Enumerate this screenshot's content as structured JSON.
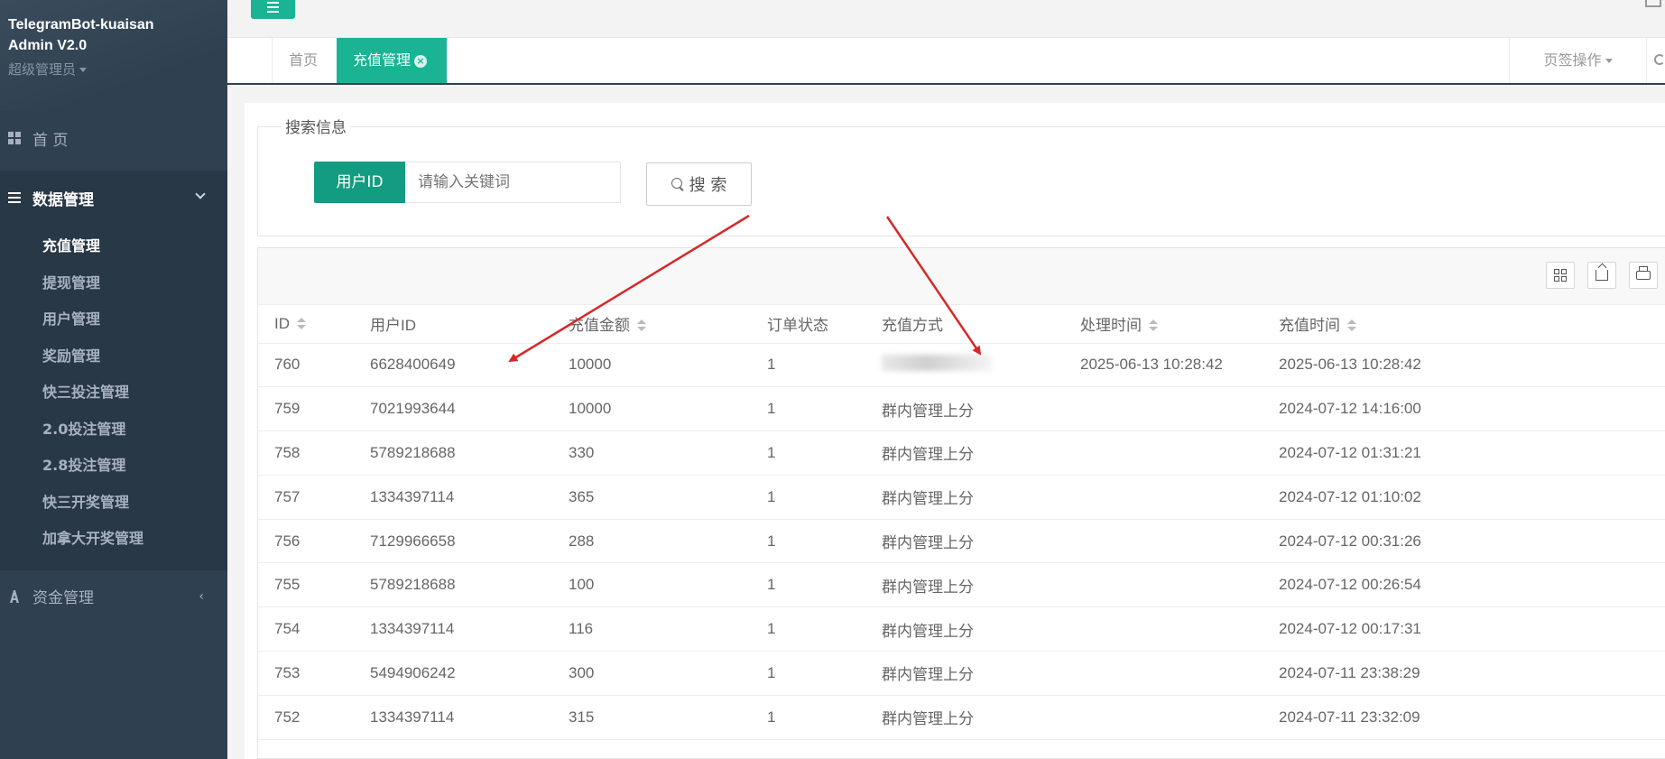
{
  "sidebar": {
    "brand_line1": "TelegramBot-kuaisan",
    "brand_line2": "Admin V2.0",
    "role": "超级管理员",
    "home": "首 页",
    "data_mgmt": "数据管理",
    "sub_items": [
      "充值管理",
      "提现管理",
      "用户管理",
      "奖励管理",
      "快三投注管理",
      "2.0投注管理",
      "2.8投注管理",
      "快三开奖管理",
      "加拿大开奖管理"
    ],
    "fund_mgmt": "资金管理"
  },
  "tabs": {
    "home": "首页",
    "active": "充值管理",
    "ops": "页签操作"
  },
  "search": {
    "legend": "搜索信息",
    "field_label": "用户ID",
    "placeholder": "请输入关键词",
    "button": "搜 索"
  },
  "table": {
    "columns": [
      "ID",
      "用户ID",
      "充值金额",
      "订单状态",
      "充值方式",
      "处理时间",
      "充值时间"
    ],
    "rows": [
      {
        "id": "760",
        "uid": "6628400649",
        "amount": "10000",
        "status": "1",
        "method": "",
        "processed": "2025-06-13 10:28:42",
        "time": "2025-06-13 10:28:42"
      },
      {
        "id": "759",
        "uid": "7021993644",
        "amount": "10000",
        "status": "1",
        "method": "群内管理上分",
        "processed": "",
        "time": "2024-07-12 14:16:00"
      },
      {
        "id": "758",
        "uid": "5789218688",
        "amount": "330",
        "status": "1",
        "method": "群内管理上分",
        "processed": "",
        "time": "2024-07-12 01:31:21"
      },
      {
        "id": "757",
        "uid": "1334397114",
        "amount": "365",
        "status": "1",
        "method": "群内管理上分",
        "processed": "",
        "time": "2024-07-12 01:10:02"
      },
      {
        "id": "756",
        "uid": "7129966658",
        "amount": "288",
        "status": "1",
        "method": "群内管理上分",
        "processed": "",
        "time": "2024-07-12 00:31:26"
      },
      {
        "id": "755",
        "uid": "5789218688",
        "amount": "100",
        "status": "1",
        "method": "群内管理上分",
        "processed": "",
        "time": "2024-07-12 00:26:54"
      },
      {
        "id": "754",
        "uid": "1334397114",
        "amount": "116",
        "status": "1",
        "method": "群内管理上分",
        "processed": "",
        "time": "2024-07-12 00:17:31"
      },
      {
        "id": "753",
        "uid": "5494906242",
        "amount": "300",
        "status": "1",
        "method": "群内管理上分",
        "processed": "",
        "time": "2024-07-11 23:38:29"
      },
      {
        "id": "752",
        "uid": "1334397114",
        "amount": "315",
        "status": "1",
        "method": "群内管理上分",
        "processed": "",
        "time": "2024-07-11 23:32:09"
      }
    ]
  },
  "colors": {
    "sidebar_bg": "#2f4050",
    "accent": "#1ab394",
    "arrow": "#d62728"
  }
}
